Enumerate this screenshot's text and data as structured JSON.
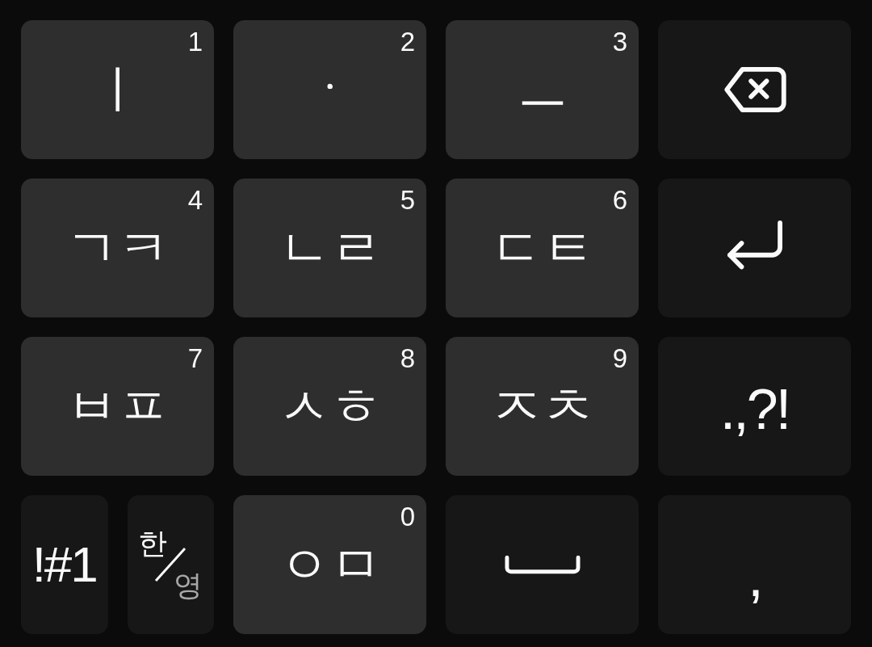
{
  "keyboard": {
    "rows": [
      {
        "keys": [
          {
            "kind": "letter",
            "label": "ㅣ",
            "number": "1"
          },
          {
            "kind": "letter",
            "label": "ㆍ",
            "number": "2"
          },
          {
            "kind": "letter",
            "label": "ㅡ",
            "number": "3"
          },
          {
            "kind": "backspace"
          }
        ]
      },
      {
        "keys": [
          {
            "kind": "letter",
            "label": "ㄱㅋ",
            "number": "4"
          },
          {
            "kind": "letter",
            "label": "ㄴㄹ",
            "number": "5"
          },
          {
            "kind": "letter",
            "label": "ㄷㅌ",
            "number": "6"
          },
          {
            "kind": "enter"
          }
        ]
      },
      {
        "keys": [
          {
            "kind": "letter",
            "label": "ㅂㅍ",
            "number": "7"
          },
          {
            "kind": "letter",
            "label": "ㅅㅎ",
            "number": "8"
          },
          {
            "kind": "letter",
            "label": "ㅈㅊ",
            "number": "9"
          },
          {
            "kind": "symbol",
            "label": ".,?!"
          }
        ]
      },
      {
        "keys": [
          {
            "kind": "mode",
            "label": "!#1"
          },
          {
            "kind": "language",
            "options": [
              {
                "label": "한",
                "selected": true
              },
              {
                "label": "영",
                "selected": false
              }
            ]
          },
          {
            "kind": "letter",
            "label": "ㅇㅁ",
            "number": "0"
          },
          {
            "kind": "space"
          },
          {
            "kind": "symbol",
            "label": ","
          }
        ]
      }
    ]
  }
}
